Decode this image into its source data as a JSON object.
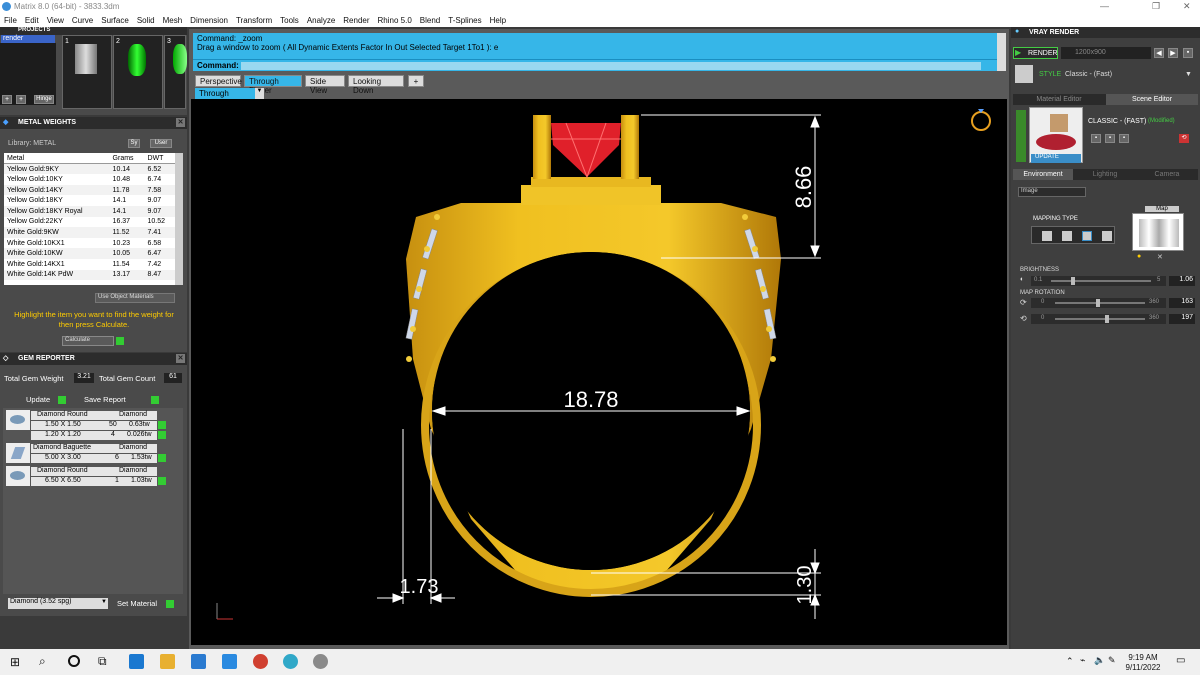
{
  "title": "Matrix 8.0 (64-bit) - 3833.3dm",
  "menu": [
    "File",
    "Edit",
    "View",
    "Curve",
    "Surface",
    "Solid",
    "Mesh",
    "Dimension",
    "Transform",
    "Tools",
    "Analyze",
    "Render",
    "Rhino 5.0",
    "Blend",
    "T-Splines",
    "Help"
  ],
  "projects": {
    "header": "PROJECTS",
    "item": "render",
    "thumbs": [
      "1",
      "2",
      "3"
    ],
    "hinge_label": "Hinge"
  },
  "metal": {
    "header": "METAL WEIGHTS",
    "library": "Library: METAL",
    "sys_label": "Sy",
    "user_label": "User",
    "cols": [
      "Metal",
      "Grams",
      "DWT"
    ],
    "rows": [
      [
        "Yellow Gold:9KY",
        "10.14",
        "6.52"
      ],
      [
        "Yellow Gold:10KY",
        "10.48",
        "6.74"
      ],
      [
        "Yellow Gold:14KY",
        "11.78",
        "7.58"
      ],
      [
        "Yellow Gold:18KY",
        "14.1",
        "9.07"
      ],
      [
        "Yellow Gold:18KY Royal",
        "14.1",
        "9.07"
      ],
      [
        "Yellow Gold:22KY",
        "16.37",
        "10.52"
      ],
      [
        "White Gold:9KW",
        "11.52",
        "7.41"
      ],
      [
        "White Gold:10KX1",
        "10.23",
        "6.58"
      ],
      [
        "White Gold:10KW",
        "10.05",
        "6.47"
      ],
      [
        "White Gold:14KX1",
        "11.54",
        "7.42"
      ],
      [
        "White Gold:14K PdW",
        "13.17",
        "8.47"
      ]
    ],
    "use_obj": "Use Object Materials",
    "hint": "Highlight the item you want to find the weight for then press Calculate.",
    "calculate": "Calculate"
  },
  "gem": {
    "header": "GEM REPORTER",
    "total_weight_label": "Total Gem Weight",
    "total_weight": "3.21",
    "total_count_label": "Total Gem Count",
    "total_count": "61",
    "update": "Update",
    "save": "Save Report",
    "groups": [
      {
        "name": "Diamond Round",
        "mat": "Diamond",
        "rows": [
          [
            "1.50 X 1.50",
            "50",
            "0.63tw"
          ],
          [
            "1.20 X 1.20",
            "4",
            "0.026tw"
          ]
        ]
      },
      {
        "name": "Diamond Baguette",
        "mat": "Diamond",
        "rows": [
          [
            "5.00 X 3.00",
            "6",
            "1.53tw"
          ]
        ]
      },
      {
        "name": "Diamond Round",
        "mat": "Diamond",
        "rows": [
          [
            "6.50 X 6.50",
            "1",
            "1.03tw"
          ]
        ]
      }
    ],
    "material_select": "Diamond     (3.52 spg)",
    "set_material": "Set Material"
  },
  "command": {
    "line1": "Command: _zoom",
    "line2": "Drag a window to zoom ( All  Dynamic  Extents  Factor  In  Out  Selected  Target  1To1 ): e",
    "prompt": "Command:"
  },
  "tabs": [
    "Perspective",
    "Through Finger",
    "Side View",
    "Looking Down",
    "+"
  ],
  "active_view": "Through Finger",
  "dims": {
    "top": "8.66",
    "width": "18.78",
    "thick": "1.73",
    "bottom": "1.30"
  },
  "vray": {
    "header": "VRAY RENDER",
    "render": "RENDER",
    "resolution": "1200x900",
    "style_label": "STYLE",
    "style": "Classic - (Fast)",
    "tabs": [
      "Material Editor",
      "Scene Editor"
    ],
    "preset": "CLASSIC - (FAST)",
    "modified": "(Modified)",
    "update": "UPDATE",
    "env_tabs": [
      "Environment",
      "Lighting",
      "Camera"
    ],
    "image_select": "Image",
    "mapping": "MAPPING TYPE",
    "map": "Map",
    "brightness": "BRIGHTNESS",
    "b_min": "0.1",
    "b_max": "5",
    "b_val": "1.06",
    "map_rotation": "MAP ROTATION",
    "r1_min": "0",
    "r1_max": "360",
    "r1_val": "163",
    "r2_min": "0",
    "r2_max": "360",
    "r2_val": "197",
    "brightness_level": 0.2,
    "r1_level": 0.45,
    "r2_level": 0.55
  },
  "clock": {
    "time": "9:19 AM",
    "date": "9/11/2022"
  },
  "colors": {
    "accent": "#36b6e8",
    "gold": "#e8b820",
    "ruby": "#e0202a"
  }
}
